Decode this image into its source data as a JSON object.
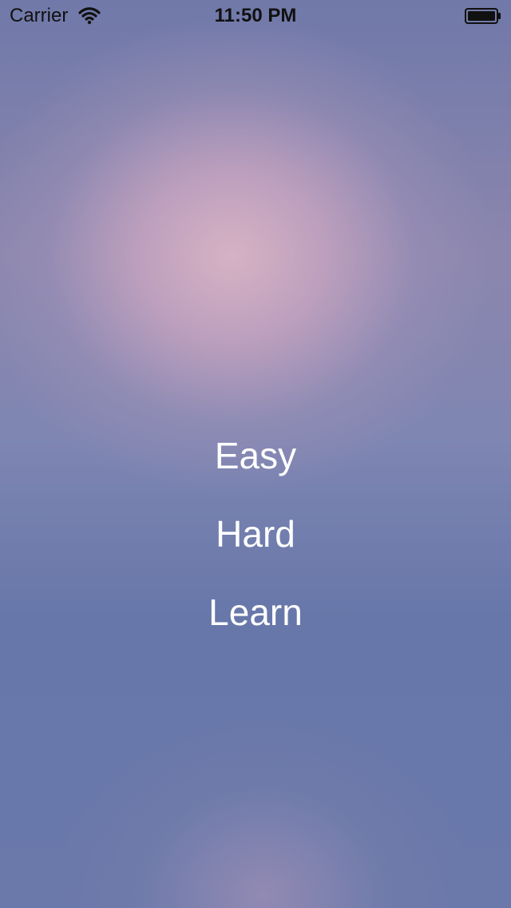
{
  "status_bar": {
    "carrier": "Carrier",
    "time": "11:50 PM",
    "wifi_icon": "wifi-icon",
    "battery_icon": "battery-icon"
  },
  "menu": {
    "items": [
      {
        "label": "Easy"
      },
      {
        "label": "Hard"
      },
      {
        "label": "Learn"
      }
    ]
  },
  "colors": {
    "text": "#FFFFFF",
    "status_text": "#111111",
    "glow_pink": "#D6B2C4",
    "background_blue": "#6777A9"
  }
}
